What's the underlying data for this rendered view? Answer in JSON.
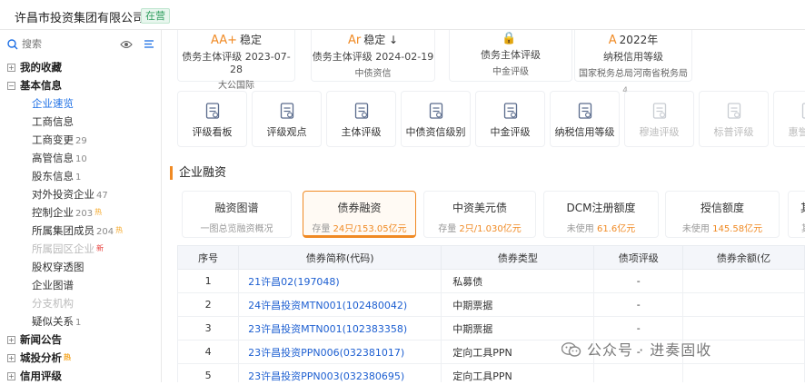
{
  "header": {
    "company": "许昌市投资集团有限公司",
    "status": "在营"
  },
  "search": {
    "placeholder": "搜索"
  },
  "nav": [
    {
      "label": "我的收藏",
      "level": 1,
      "sign": "+"
    },
    {
      "label": "基本信息",
      "level": 1,
      "sign": "−"
    },
    {
      "label": "企业速览",
      "level": 2,
      "active": true
    },
    {
      "label": "工商信息",
      "level": 2
    },
    {
      "label": "工商变更",
      "level": 2,
      "count": "29"
    },
    {
      "label": "高管信息",
      "level": 2,
      "count": "10"
    },
    {
      "label": "股东信息",
      "level": 2,
      "count": "1"
    },
    {
      "label": "对外投资企业",
      "level": 2,
      "count": "47"
    },
    {
      "label": "控制企业",
      "level": 2,
      "count": "203",
      "tag": "热"
    },
    {
      "label": "所属集团成员",
      "level": 2,
      "count": "204",
      "tag": "热"
    },
    {
      "label": "所属园区企业",
      "level": 2,
      "disabled": true,
      "tag": "新"
    },
    {
      "label": "股权穿透图",
      "level": 2
    },
    {
      "label": "企业图谱",
      "level": 2
    },
    {
      "label": "分支机构",
      "level": 2,
      "disabled": true
    },
    {
      "label": "疑似关系",
      "level": 2,
      "count": "1"
    },
    {
      "label": "新闻公告",
      "level": 1,
      "sign": "+"
    },
    {
      "label": "城投分析",
      "level": 1,
      "sign": "+",
      "tag": "热"
    },
    {
      "label": "信用评级",
      "level": 1,
      "sign": "+"
    }
  ],
  "ratings": [
    {
      "grade": "AA+",
      "trend": "稳定",
      "line": "债务主体评级 2023-07-28",
      "agency": "大公国际"
    },
    {
      "grade": "Ar",
      "trend": "稳定 ↓",
      "line": "债务主体评级 2024-02-19",
      "agency": "中债资信"
    },
    {
      "grade": "🔒",
      "trend": "",
      "line": "债务主体评级",
      "agency": "中金评级"
    },
    {
      "grade": "A",
      "trend": "2022年",
      "line": "纳税信用等级",
      "agency": "国家税务总局河南省税务局"
    }
  ],
  "tiles": [
    {
      "label": "评级看板",
      "icon": "board-icon"
    },
    {
      "label": "评级观点",
      "icon": "opinion-icon"
    },
    {
      "label": "主体评级",
      "icon": "entity-rating-icon"
    },
    {
      "label": "中债资信级别",
      "icon": "chinabond-icon"
    },
    {
      "label": "中金评级",
      "icon": "cicc-icon"
    },
    {
      "label": "纳税信用等级",
      "icon": "tax-credit-icon",
      "badge": "4"
    },
    {
      "label": "穆迪评级",
      "icon": "moodys-icon",
      "disabled": true
    },
    {
      "label": "标普评级",
      "icon": "sp-icon",
      "disabled": true
    },
    {
      "label": "惠誉评级",
      "icon": "fitch-icon",
      "disabled": true
    }
  ],
  "section_title": "企业融资",
  "fin_tabs": [
    {
      "title": "融资图谱",
      "pre": "一图总览融资概况",
      "hl": "",
      "post": ""
    },
    {
      "title": "债券融资",
      "pre": "存量 ",
      "hl": "24只/153.05亿元",
      "post": "",
      "selected": true
    },
    {
      "title": "中资美元债",
      "pre": "存量 ",
      "hl": "2只/1.030亿元",
      "post": ""
    },
    {
      "title": "DCM注册额度",
      "pre": "未使用 ",
      "hl": "61.6亿元",
      "post": ""
    },
    {
      "title": "授信额度",
      "pre": "未使用 ",
      "hl": "145.58亿元",
      "post": ""
    },
    {
      "title": "其",
      "pre": "其",
      "hl": "",
      "post": ""
    }
  ],
  "table": {
    "headers": [
      "序号",
      "债券简称(代码)",
      "债券类型",
      "债项评级",
      "债券余额(亿"
    ],
    "rows": [
      [
        "1",
        "21许昌02(197048)",
        "私募债",
        "-",
        ""
      ],
      [
        "2",
        "24许昌投资MTN001(102480042)",
        "中期票据",
        "-",
        ""
      ],
      [
        "3",
        "23许昌投资MTN001(102383358)",
        "中期票据",
        "-",
        ""
      ],
      [
        "4",
        "23许昌投资PPN006(032381017)",
        "定向工具PPN",
        "-",
        ""
      ],
      [
        "5",
        "23许昌投资PPN003(032380695)",
        "定向工具PPN",
        "",
        ""
      ]
    ]
  },
  "watermark": "公众号 · 进奏固收",
  "colors": {
    "accent": "#f08a24",
    "link": "#1d5fd1",
    "active": "#1d6fe5"
  }
}
